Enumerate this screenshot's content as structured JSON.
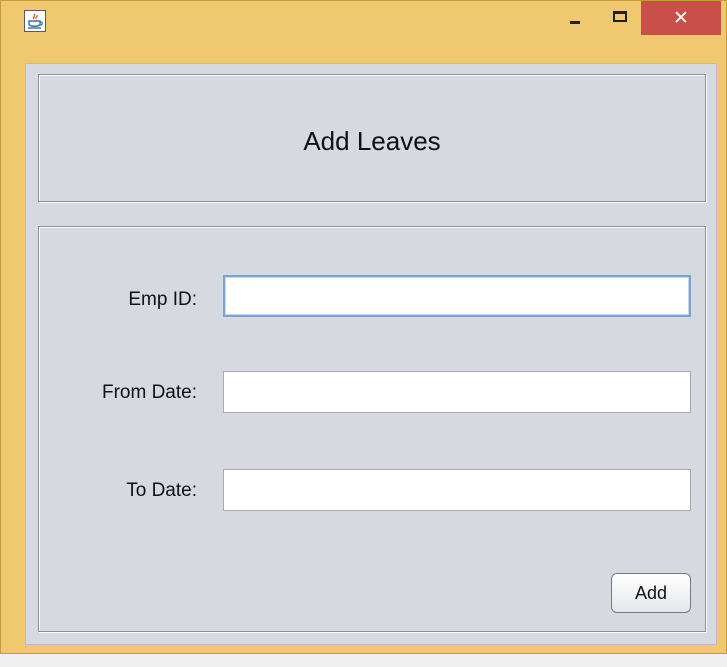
{
  "window": {
    "app_icon": "java-coffee-cup-icon",
    "controls": {
      "minimize_icon": "minimize-icon",
      "maximize_icon": "maximize-icon",
      "close_icon": "close-icon",
      "close_glyph": "✕"
    },
    "colors": {
      "frame": "#f0c870",
      "close_button": "#c9504a",
      "content_bg": "#d6d9df"
    }
  },
  "header": {
    "title": "Add Leaves"
  },
  "form": {
    "fields": [
      {
        "label": "Emp ID:",
        "value": "",
        "placeholder": ""
      },
      {
        "label": "From Date:",
        "value": "",
        "placeholder": ""
      },
      {
        "label": "To Date:",
        "value": "",
        "placeholder": ""
      }
    ],
    "add_label": "Add"
  }
}
